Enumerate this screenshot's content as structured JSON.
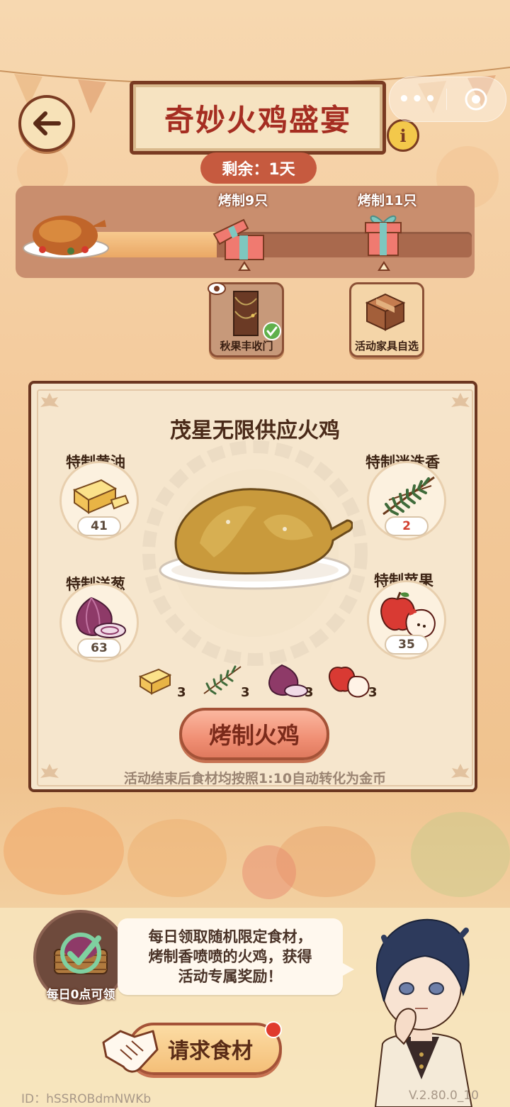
{
  "header": {
    "title": "奇妙火鸡盛宴",
    "remaining": "剩余：1天",
    "capsule_more": "•••"
  },
  "progress": {
    "milestones": [
      {
        "label": "烤制9只",
        "reward": "秋果丰收门",
        "claimed": true
      },
      {
        "label": "烤制11只",
        "reward": "活动家具自选",
        "claimed": false
      }
    ],
    "fill_fraction": 0.34
  },
  "card": {
    "title": "茂星无限供应火鸡",
    "ingredients": [
      {
        "name": "特制黄油",
        "count": "41"
      },
      {
        "name": "特制迷迭香",
        "count": "2"
      },
      {
        "name": "特制洋葱",
        "count": "63"
      },
      {
        "name": "特制苹果",
        "count": "35"
      }
    ],
    "costs": [
      "3",
      "3",
      "3",
      "3"
    ],
    "roast_button": "烤制火鸡",
    "note": "活动结束后食材均按照1:10自动转化为金币"
  },
  "bottom": {
    "daily_label": "每日0点可领",
    "speech_lines": [
      "每日领取随机限定食材，",
      "烤制香喷喷的火鸡，获得",
      "活动专属奖励！"
    ],
    "request_button": "请求食材"
  },
  "footer": {
    "id": "ID：hSSROBdmNWKb",
    "version": "V.2.80.0_10"
  },
  "colors": {
    "accent": "#a52d21",
    "border": "#7a3b22",
    "button": "#f08f74"
  }
}
